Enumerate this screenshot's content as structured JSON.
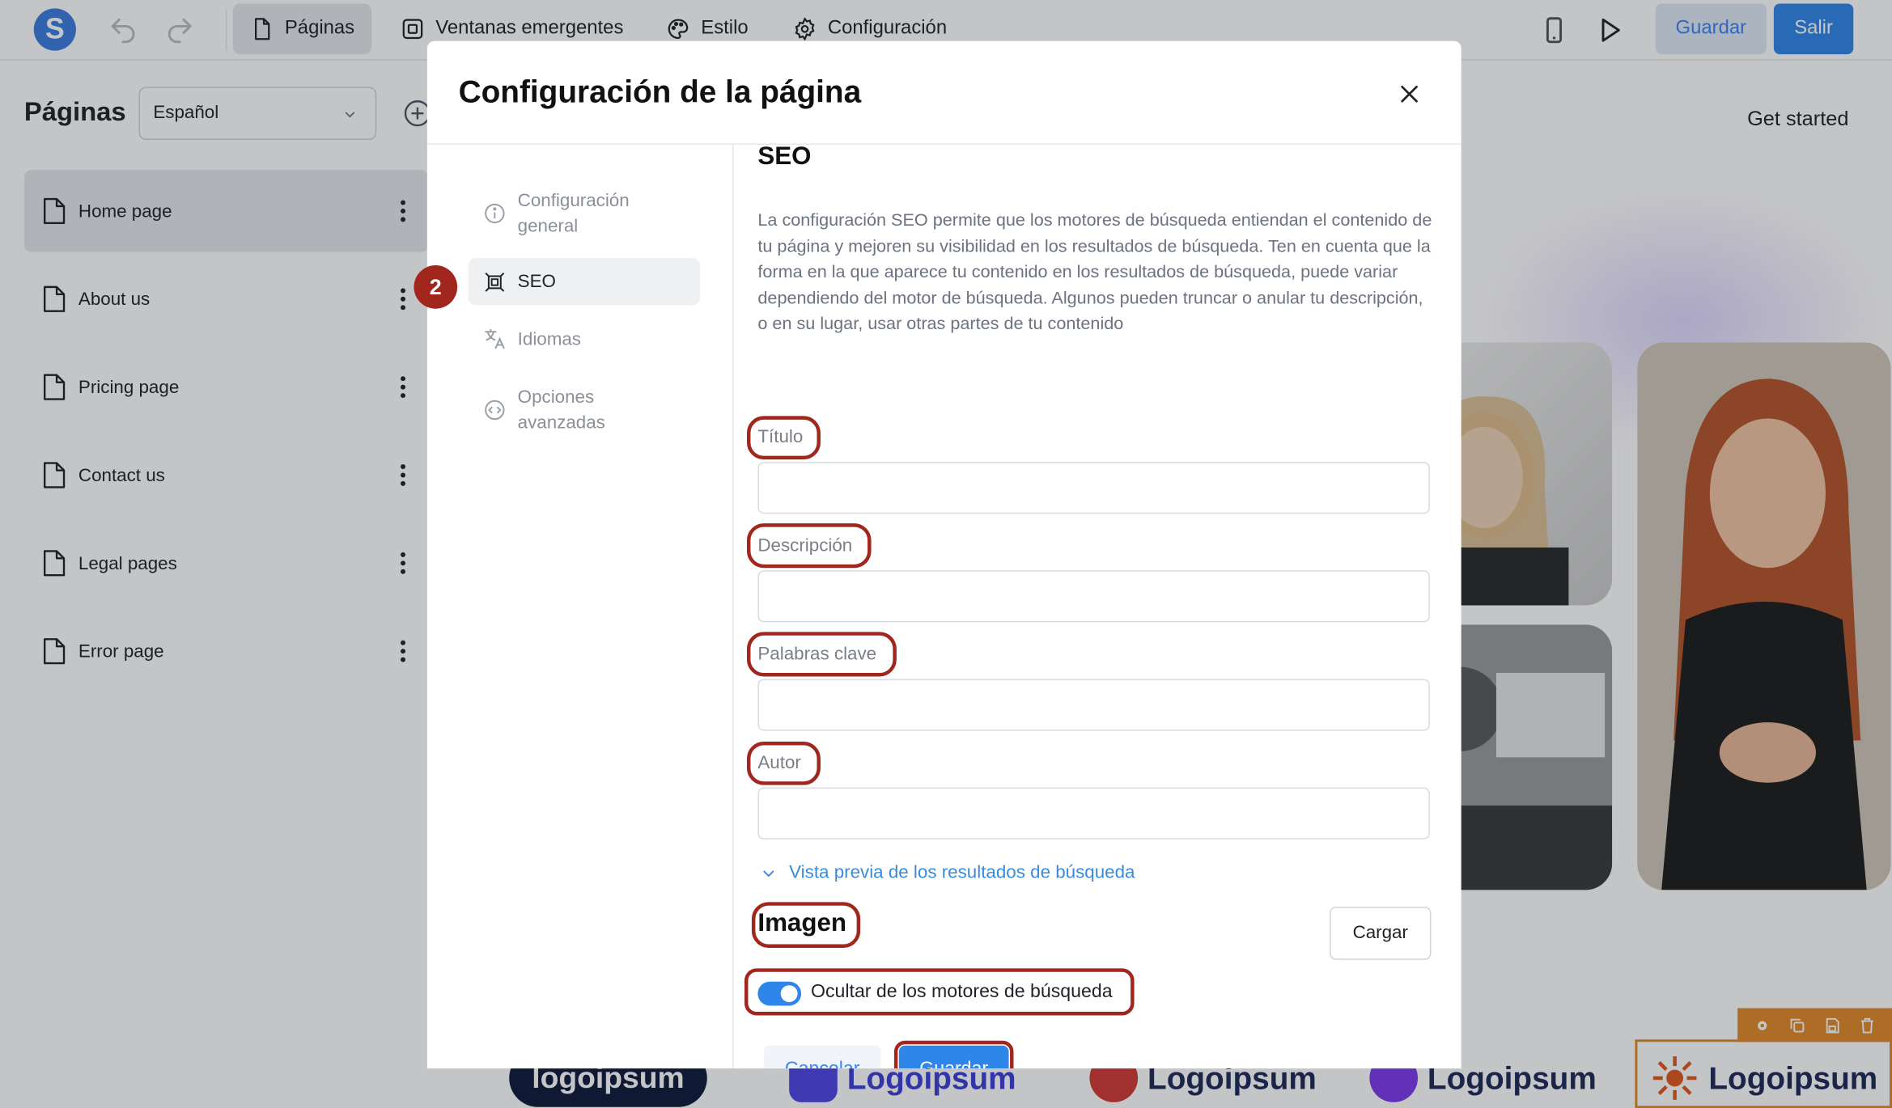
{
  "app": {
    "logo_letter": "S",
    "tabs": [
      {
        "label": "Páginas",
        "icon": "page-icon",
        "active": true
      },
      {
        "label": "Ventanas emergentes",
        "icon": "popup-icon",
        "active": false
      },
      {
        "label": "Estilo",
        "icon": "palette-icon",
        "active": false
      },
      {
        "label": "Configuración",
        "icon": "gear-icon",
        "active": false
      }
    ],
    "save_label": "Guardar",
    "exit_label": "Salir"
  },
  "pages_panel": {
    "title": "Páginas",
    "language": "Español",
    "items": [
      {
        "label": "Home page",
        "active": true
      },
      {
        "label": "About us",
        "active": false
      },
      {
        "label": "Pricing page",
        "active": false
      },
      {
        "label": "Contact us",
        "active": false
      },
      {
        "label": "Legal pages",
        "active": false
      },
      {
        "label": "Error page",
        "active": false
      }
    ]
  },
  "preview": {
    "cta": "Get started",
    "logos": [
      "logoipsum",
      "Logoipsum",
      "Logoipsum",
      "Logoipsum",
      "Logoipsum"
    ]
  },
  "modal": {
    "title": "Configuración de la página",
    "nav": [
      {
        "label": "Configuración general",
        "icon": "info-icon",
        "active": false
      },
      {
        "label": "SEO",
        "icon": "seo-icon",
        "active": true
      },
      {
        "label": "Idiomas",
        "icon": "translate-icon",
        "active": false
      },
      {
        "label": "Opciones avanzadas",
        "icon": "code-icon",
        "active": false
      }
    ],
    "seo": {
      "heading": "SEO",
      "description": "La configuración SEO permite que los motores de búsqueda entiendan el contenido de tu página y mejoren su visibilidad en los resultados de búsqueda. Ten en cuenta que la forma en la que aparece tu contenido en los resultados de búsqueda, puede variar dependiendo del motor de búsqueda. Algunos pueden truncar o anular tu descripción, o en su lugar, usar otras partes de tu contenido",
      "fields": [
        {
          "label": "Título",
          "value": ""
        },
        {
          "label": "Descripción",
          "value": ""
        },
        {
          "label": "Palabras clave",
          "value": ""
        },
        {
          "label": "Autor",
          "value": ""
        }
      ],
      "preview_link": "Vista previa de los resultados de búsqueda",
      "image_heading": "Imagen",
      "upload_label": "Cargar",
      "hide_toggle_label": "Ocultar de los motores de búsqueda",
      "hide_toggle_on": true
    },
    "cancel_label": "Cancelar",
    "save_label": "Guardar"
  },
  "annotation": {
    "step": "2"
  },
  "colors": {
    "accent": "#2f86e9",
    "annotation": "#a1261d",
    "selection": "#e08a2b"
  }
}
